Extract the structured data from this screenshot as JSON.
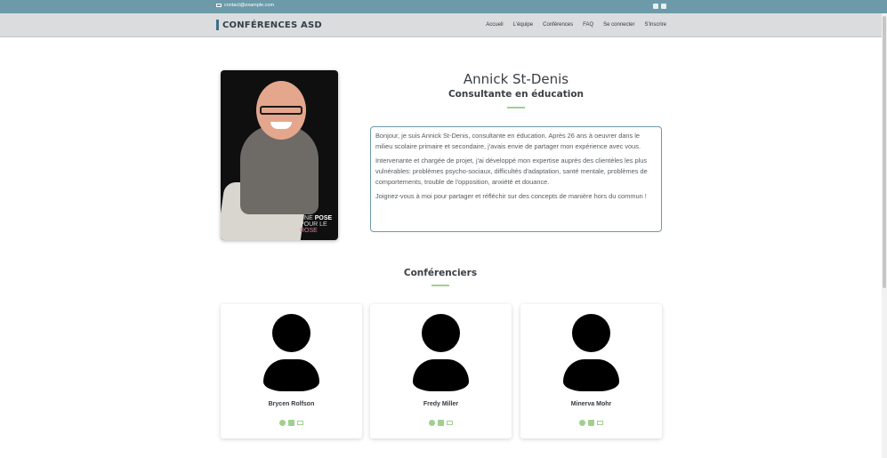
{
  "topbar": {
    "email": "contact@example.com",
    "email_icon": "envelope-icon",
    "social_icons": [
      "facebook-icon",
      "linkedin-icon"
    ]
  },
  "navbar": {
    "brand": "CONFÉRENCES ASD",
    "links": [
      "Accueil",
      "L'équipe",
      "Conférences",
      "FAQ",
      "Se connecter",
      "S'inscrire"
    ]
  },
  "profile": {
    "name": "Annick St-Denis",
    "role": "Consultante en éducation",
    "photo_watermark": [
      "UNE",
      "POSE",
      "POUR LE",
      "ROSE"
    ],
    "bio": [
      "Bonjour, je suis Annick St-Denis, consultante en éducation. Après 26 ans à oeuvrer dans le milieu scolaire primaire et secondaire, j'avais envie de partager mon expérience avec vous.",
      "Intervenante et chargée de projet, j'ai développé mon expertise auprès des clientèles les plus vulnérables: problèmes psycho-sociaux, difficultés d'adaptation, santé mentale, problèmes de comportements, trouble de l'opposition, anxiété et douance.",
      "Joignez-vous à moi pour partager et réfléchir sur des concepts de manière hors du commun !"
    ]
  },
  "speakers": {
    "title": "Conférenciers",
    "items": [
      {
        "name": "Brycen Rolfson"
      },
      {
        "name": "Fredy Miller"
      },
      {
        "name": "Minerva Mohr"
      }
    ],
    "social_icons": [
      "facebook-icon",
      "linkedin-icon",
      "envelope-icon"
    ],
    "accent": "#9fd08f"
  },
  "colors": {
    "topbar": "#6c9aa9",
    "navbar": "#dadcde",
    "brand_bar": "#3f6f86",
    "accent": "#9fd08f"
  }
}
